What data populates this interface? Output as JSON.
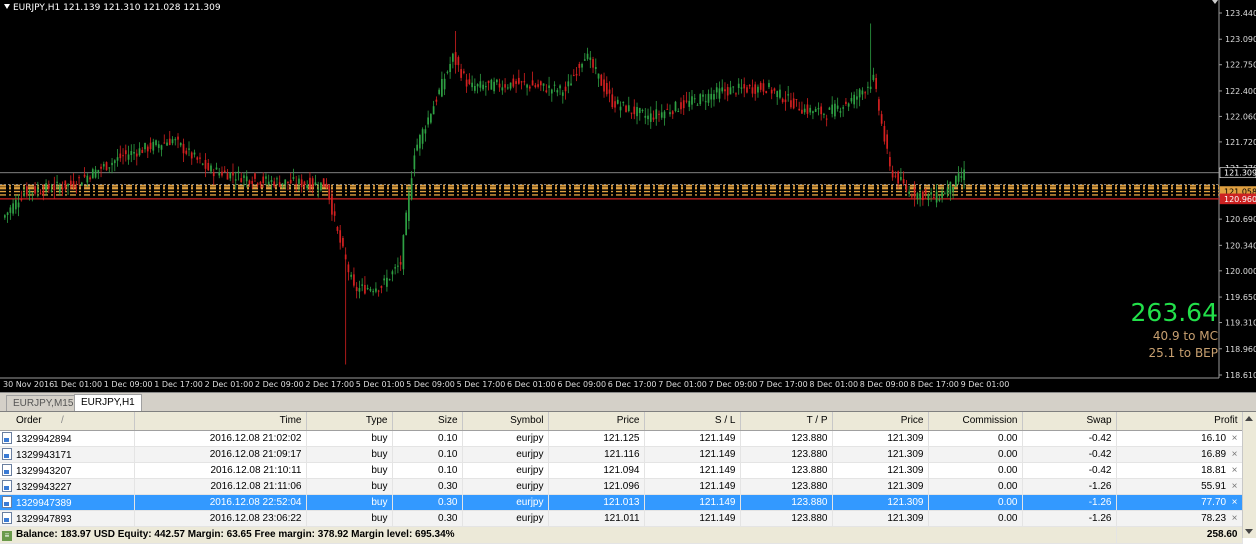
{
  "chart": {
    "symbol_line": "EURJPY,H1  121.139 121.310 121.028 121.309",
    "price_axis": [
      "123.440",
      "123.090",
      "122.750",
      "122.400",
      "122.060",
      "121.720",
      "121.370",
      "121.030",
      "120.690",
      "120.340",
      "120.000",
      "119.650",
      "119.310",
      "118.960",
      "118.610"
    ],
    "time_axis": [
      "30 Nov 2016",
      "1 Dec 01:00",
      "1 Dec 09:00",
      "1 Dec 17:00",
      "2 Dec 01:00",
      "2 Dec 09:00",
      "2 Dec 17:00",
      "5 Dec 01:00",
      "5 Dec 09:00",
      "5 Dec 17:00",
      "6 Dec 01:00",
      "6 Dec 09:00",
      "6 Dec 17:00",
      "7 Dec 01:00",
      "7 Dec 09:00",
      "7 Dec 17:00",
      "8 Dec 01:00",
      "8 Dec 09:00",
      "8 Dec 17:00",
      "9 Dec 01:00"
    ],
    "price_tags": [
      {
        "text": "121.309",
        "bg": "#000000",
        "fg": "#ffffff",
        "border": "#ffffff"
      },
      {
        "text": "121.058",
        "bg": "#e0a040",
        "fg": "#000000",
        "border": "#e0a040"
      },
      {
        "text": "120.960",
        "bg": "#cc2222",
        "fg": "#ffffff",
        "border": "#cc2222"
      }
    ],
    "overlay": {
      "profit": "263.64",
      "mc": "40.9  to MC",
      "bep": "25.1  to BEP"
    },
    "colors": {
      "bull": "#2ea043",
      "bear": "#d42020",
      "wick": "#cccccc"
    }
  },
  "tabs": [
    {
      "label": "EURJPY,M15",
      "active": false
    },
    {
      "label": "EURJPY,H1",
      "active": true
    }
  ],
  "terminal": {
    "headers": [
      "Order",
      "Time",
      "Type",
      "Size",
      "Symbol",
      "Price",
      "S / L",
      "T / P",
      "Price",
      "Commission",
      "Swap",
      "Profit"
    ],
    "sort_mark": "/",
    "rows": [
      [
        "1329942894",
        "2016.12.08 21:02:02",
        "buy",
        "0.10",
        "eurjpy",
        "121.125",
        "121.149",
        "123.880",
        "121.309",
        "0.00",
        "-0.42",
        "16.10"
      ],
      [
        "1329943171",
        "2016.12.08 21:09:17",
        "buy",
        "0.10",
        "eurjpy",
        "121.116",
        "121.149",
        "123.880",
        "121.309",
        "0.00",
        "-0.42",
        "16.89"
      ],
      [
        "1329943207",
        "2016.12.08 21:10:11",
        "buy",
        "0.10",
        "eurjpy",
        "121.094",
        "121.149",
        "123.880",
        "121.309",
        "0.00",
        "-0.42",
        "18.81"
      ],
      [
        "1329943227",
        "2016.12.08 21:11:06",
        "buy",
        "0.30",
        "eurjpy",
        "121.096",
        "121.149",
        "123.880",
        "121.309",
        "0.00",
        "-1.26",
        "55.91"
      ],
      [
        "1329947389",
        "2016.12.08 22:52:04",
        "buy",
        "0.30",
        "eurjpy",
        "121.013",
        "121.149",
        "123.880",
        "121.309",
        "0.00",
        "-1.26",
        "77.70"
      ],
      [
        "1329947893",
        "2016.12.08 23:06:22",
        "buy",
        "0.30",
        "eurjpy",
        "121.011",
        "121.149",
        "123.880",
        "121.309",
        "0.00",
        "-1.26",
        "78.23"
      ]
    ],
    "selected_row": 4,
    "balance": "Balance: 183.97 USD  Equity: 442.57  Margin: 63.65  Free margin: 378.92  Margin level: 695.34%",
    "total_profit": "258.60"
  }
}
